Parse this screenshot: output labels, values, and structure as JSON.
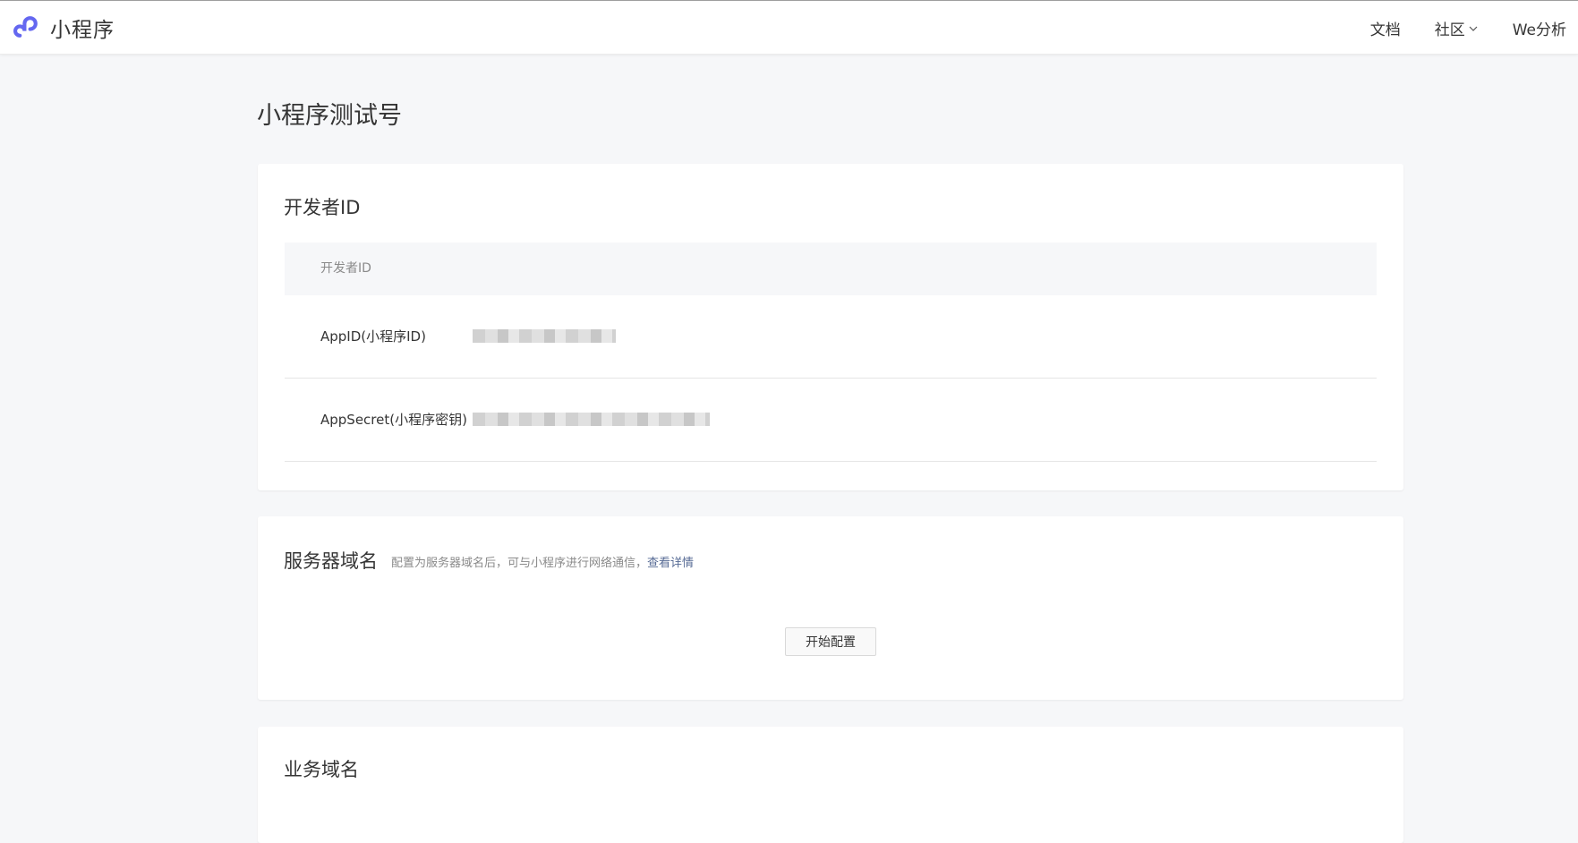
{
  "header": {
    "brand": "小程序",
    "nav": [
      {
        "label": "文档"
      },
      {
        "label": "社区"
      },
      {
        "label": "We分析"
      }
    ]
  },
  "page": {
    "title": "小程序测试号"
  },
  "developer_card": {
    "title": "开发者ID",
    "table_header": "开发者ID",
    "rows": [
      {
        "label": "AppID(小程序ID)"
      },
      {
        "label": "AppSecret(小程序密钥)"
      }
    ]
  },
  "server_card": {
    "title": "服务器域名",
    "description": "配置为服务器域名后，可与小程序进行网络通信，",
    "link": "查看详情",
    "button": "开始配置"
  },
  "business_card": {
    "title": "业务域名"
  },
  "colors": {
    "brand": "#6467f0",
    "link": "#576b95"
  }
}
